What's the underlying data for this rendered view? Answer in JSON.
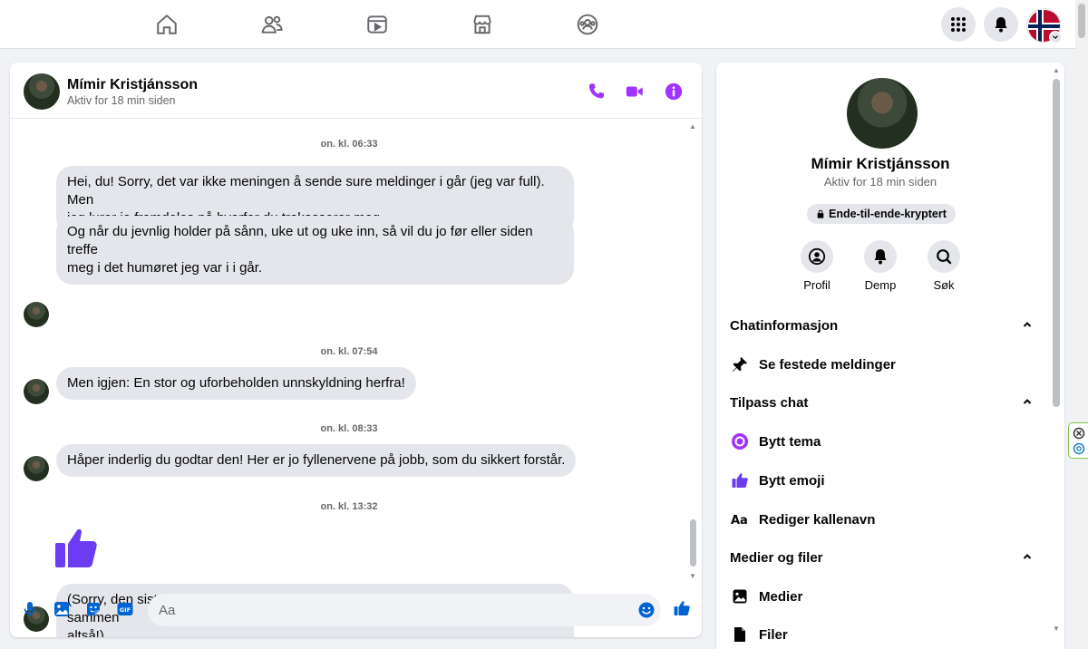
{
  "topnav": {
    "items": [
      "home-icon",
      "friends-icon",
      "video-icon",
      "marketplace-icon",
      "groups-icon"
    ]
  },
  "colors": {
    "accent": "#a033ff",
    "like_blue": "#6c3cf2",
    "bubble": "#e4e6eb",
    "secondary_text": "#65676b"
  },
  "chat": {
    "contact_name": "Mímir Kristjánsson",
    "contact_status": "Aktiv for 18 min siden",
    "messages": [
      {
        "time": "on. kl. 06:33"
      },
      {
        "text_line1": "Hei, du! Sorry, det var ikke meningen å sende sure meldinger i går (jeg var full). Men",
        "text_line2": "jeg lurer jo fremdeles på hvorfor du trakasserer meg."
      },
      {
        "text_line1": "Og når du jevnlig holder på sånn, uke ut og uke inn, så vil du jo før eller siden treffe",
        "text_line2": "meg i det humøret jeg var i i går."
      },
      {
        "time": "on. kl. 07:54"
      },
      {
        "text": "Men igjen: En stor og uforbeholden unnskyldning herfra!"
      },
      {
        "time": "on. kl. 08:33"
      },
      {
        "text": "Håper inderlig du godtar den! Her er jo fyllenervene på jobb, som du sikkert forstår."
      },
      {
        "time": "on. kl. 13:32"
      },
      {
        "text_line1": "(Sorry, den siste tommelen her var bare feiltrykk. Men beklager igjen for alt sammen",
        "text_line2": "altså!)"
      }
    ],
    "composer_placeholder": "Aa"
  },
  "info": {
    "name": "Mímir Kristjánsson",
    "status": "Aktiv for 18 min siden",
    "e2e_label": "Ende-til-ende-kryptert",
    "actions": [
      "Profil",
      "Demp",
      "Søk"
    ],
    "sections": {
      "chatinfo": "Chatinformasjon",
      "pinned": "Se festede meldinger",
      "customize": "Tilpass chat",
      "theme": "Bytt tema",
      "emoji": "Bytt emoji",
      "nickname": "Rediger kallenavn",
      "media": "Medier og filer",
      "media_item": "Medier",
      "files_item": "Filer"
    }
  }
}
